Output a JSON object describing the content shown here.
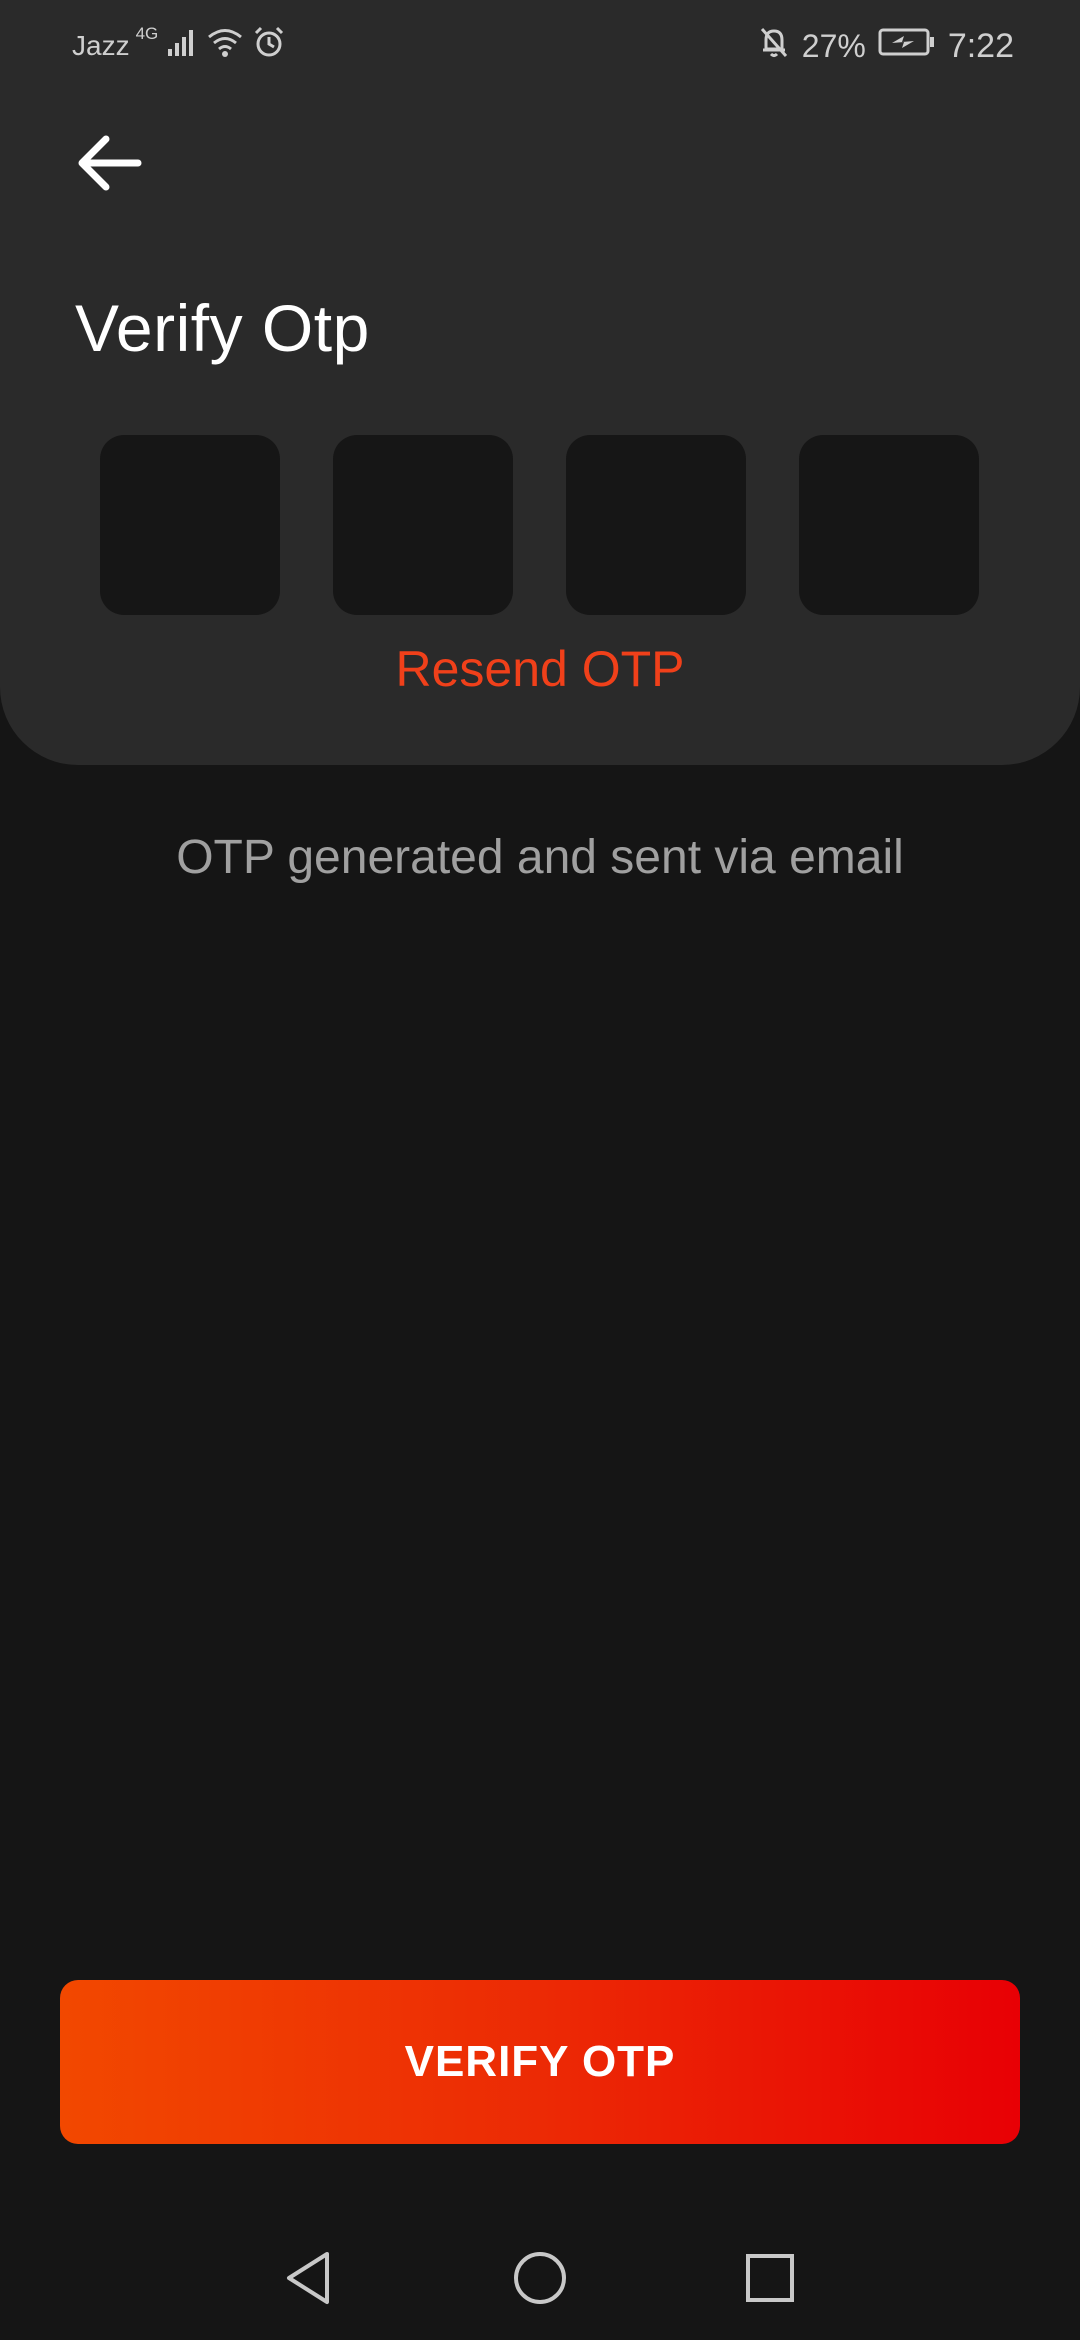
{
  "status_bar": {
    "carrier": "Jazz",
    "network_type": "4G",
    "battery_percent": "27%",
    "time": "7:22",
    "icons": [
      "signal-icon",
      "wifi-icon",
      "alarm-icon",
      "mute-bell-icon",
      "battery-charging-icon"
    ]
  },
  "header": {
    "back_icon": "arrow-left-icon",
    "title": "Verify Otp"
  },
  "otp": {
    "digits": [
      "",
      "",
      "",
      ""
    ]
  },
  "resend_label": "Resend OTP",
  "info_message": "OTP generated and sent via email",
  "verify_button_label": "VERIFY OTP",
  "nav_bar": {
    "icons": [
      "nav-back-icon",
      "nav-home-icon",
      "nav-recents-icon"
    ]
  },
  "colors": {
    "background": "#151515",
    "card": "#2a2a2a",
    "otp_box": "#161616",
    "accent": "#f0401a",
    "button_gradient_start": "#f24800",
    "button_gradient_end": "#e80005",
    "muted_text": "#a0a0a0"
  }
}
